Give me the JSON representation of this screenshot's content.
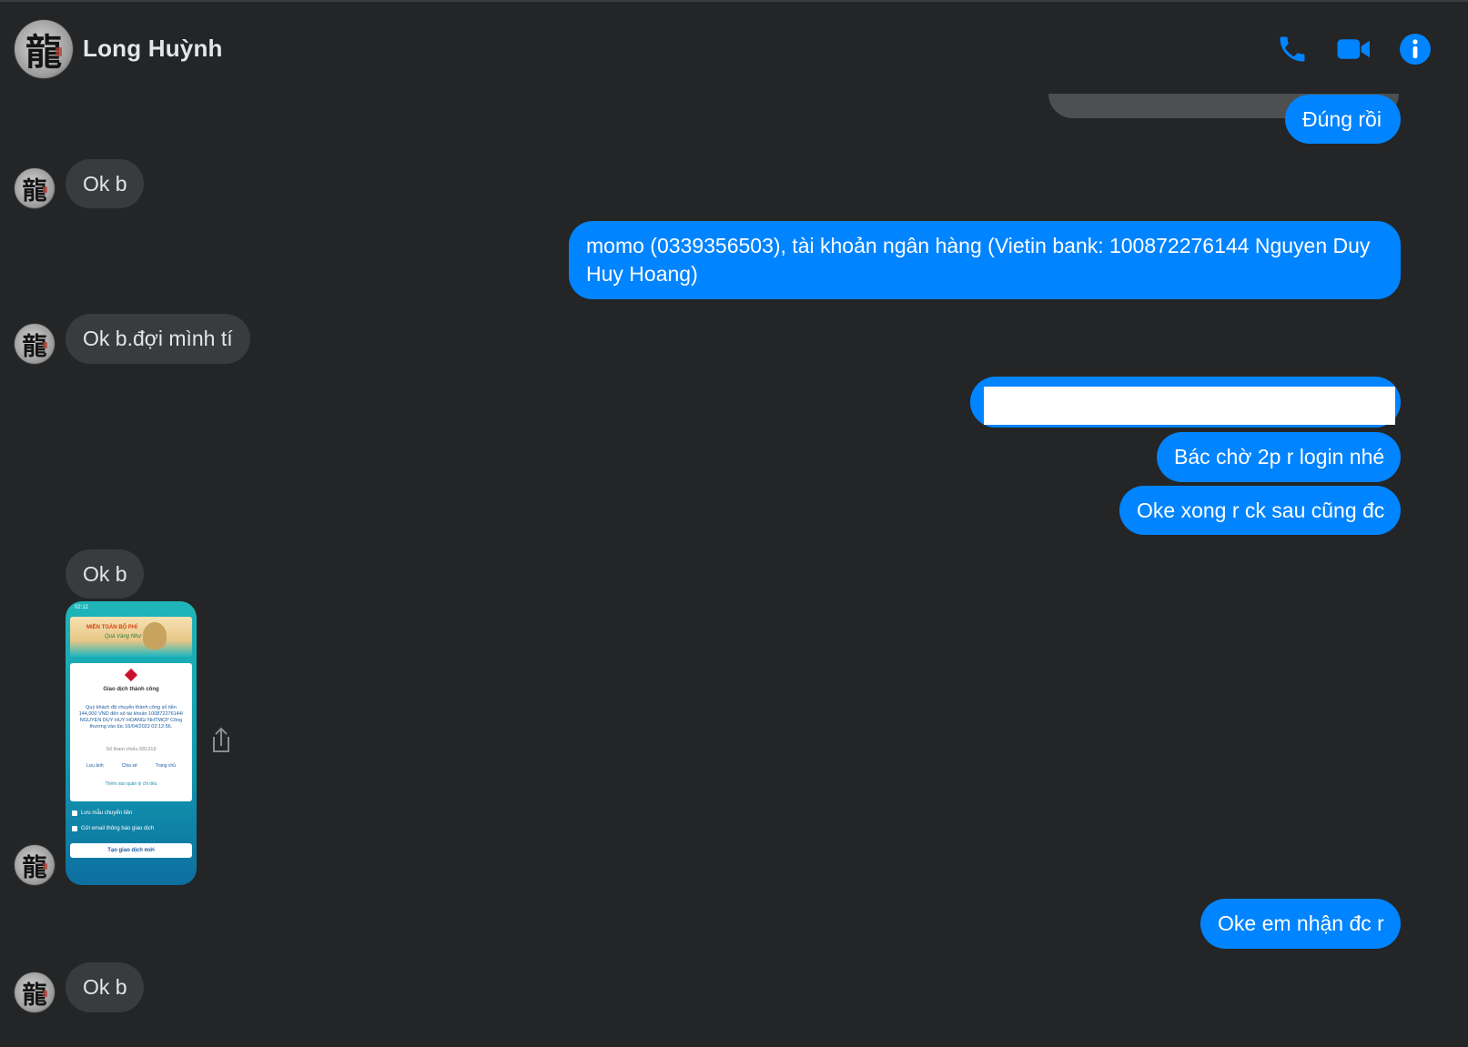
{
  "header": {
    "contact_name": "Long Huỳnh",
    "icons": [
      "phone-icon",
      "video-camera-icon",
      "info-icon"
    ],
    "accent_color": "#0084ff"
  },
  "messages": [
    {
      "side": "out",
      "text": "Đúng rồi"
    },
    {
      "side": "in",
      "text": "Ok b"
    },
    {
      "side": "out",
      "text": "momo (0339356503), tài khoản ngân hàng (Vietin bank: 100872276144 Nguyen Duy",
      "text2": "Huy Hoang)"
    },
    {
      "side": "in",
      "text": "Ok b.đợi mình tí"
    },
    {
      "side": "out",
      "text": "",
      "redacted": true
    },
    {
      "side": "out",
      "text": "Bác chờ 2p r login nhé"
    },
    {
      "side": "out",
      "text": "Oke xong r ck sau cũng đc"
    },
    {
      "side": "in",
      "text": "Ok b"
    },
    {
      "side": "out",
      "text": "Oke em nhận đc r"
    },
    {
      "side": "in",
      "text": "Ok b"
    }
  ],
  "receipt_image": {
    "status_time": "02:12",
    "banner_title": "MIỄN TOÀN BỘ PHÍ",
    "banner_subtitle": "Quà Vàng Như Ý",
    "result_title": "Giao dịch thành công",
    "result_body": "Quý khách đã chuyển thành công số tiền 144,000 VND đến số tài khoản 100872276144/ NGUYEN DUY HUY HOANG/ NHTMCP Công thương vào lúc 16/04/2022 02:12:56.",
    "reference": "Số tham chiếu 581319",
    "actions": [
      "Lưu ảnh",
      "Chia sẻ",
      "Trang chủ"
    ],
    "more_info": "Thêm vào quản lý chi tiêu",
    "checkbox_1": "Lưu mẫu chuyển tiền",
    "checkbox_2": "Gửi email thông báo giao dịch",
    "new_transaction_button": "Tạo giao dịch mới"
  }
}
